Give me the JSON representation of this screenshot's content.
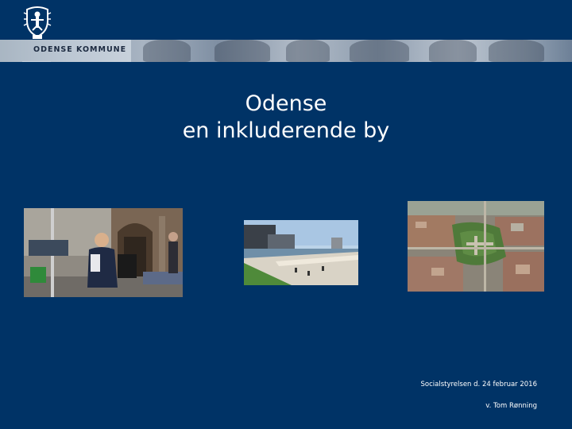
{
  "header": {
    "brand_name": "ODENSE KOMMUNE"
  },
  "title": {
    "line1": "Odense",
    "line2": "en inkluderende by"
  },
  "photos": [
    {
      "icon": "street-photo"
    },
    {
      "icon": "harbour-photo"
    },
    {
      "icon": "aerial-city-photo"
    }
  ],
  "footer": {
    "line1": "Socialstyrelsen d. 24 februar 2016",
    "line2": "v. Tom Rønning"
  },
  "colors": {
    "background": "#003366",
    "text": "#ffffff"
  }
}
